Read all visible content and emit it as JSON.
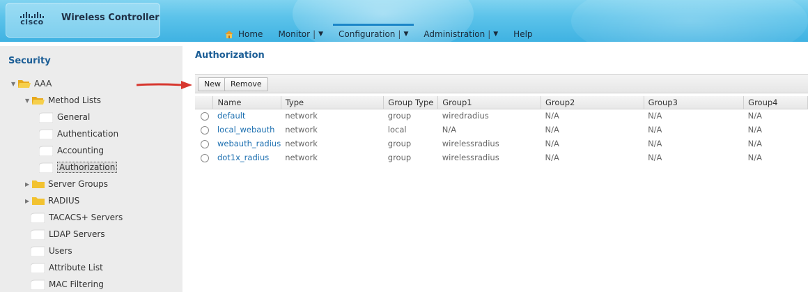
{
  "header": {
    "logo_word": "cisco",
    "title": "Wireless Controller",
    "nav": [
      {
        "label": "Home"
      },
      {
        "label": "Monitor"
      },
      {
        "label": "Configuration"
      },
      {
        "label": "Administration"
      },
      {
        "label": "Help"
      }
    ],
    "active_nav": "Configuration"
  },
  "sidebar": {
    "title": "Security",
    "tree": {
      "aaa": "AAA",
      "method_lists": "Method Lists",
      "general": "General",
      "authentication": "Authentication",
      "accounting": "Accounting",
      "authorization": "Authorization",
      "server_groups": "Server Groups",
      "radius": "RADIUS",
      "tacacs": "TACACS+ Servers",
      "ldap": "LDAP Servers",
      "users": "Users",
      "attribute_list": "Attribute List",
      "mac_filtering": "MAC Filtering"
    },
    "selected": "Authorization"
  },
  "main": {
    "heading": "Authorization",
    "toolbar": {
      "new_label": "New",
      "remove_label": "Remove"
    },
    "columns": [
      "Name",
      "Type",
      "Group Type",
      "Group1",
      "Group2",
      "Group3",
      "Group4"
    ],
    "rows": [
      [
        "default",
        "network",
        "group",
        "wiredradius",
        "N/A",
        "N/A",
        "N/A"
      ],
      [
        "local_webauth",
        "network",
        "local",
        "N/A",
        "N/A",
        "N/A",
        "N/A"
      ],
      [
        "webauth_radius",
        "network",
        "group",
        "wirelessradius",
        "N/A",
        "N/A",
        "N/A"
      ],
      [
        "dot1x_radius",
        "network",
        "group",
        "wirelessradius",
        "N/A",
        "N/A",
        "N/A"
      ]
    ]
  },
  "colors": {
    "header_blue": "#3fb2e2",
    "link_blue": "#1c6fb0",
    "heading_blue": "#1c5e96",
    "arrow_red": "#d7372f",
    "folder_yellow": "#f2c230"
  },
  "icons": [
    "home-icon",
    "folder-icon",
    "page-icon",
    "radio-icon",
    "arrow-icon"
  ]
}
